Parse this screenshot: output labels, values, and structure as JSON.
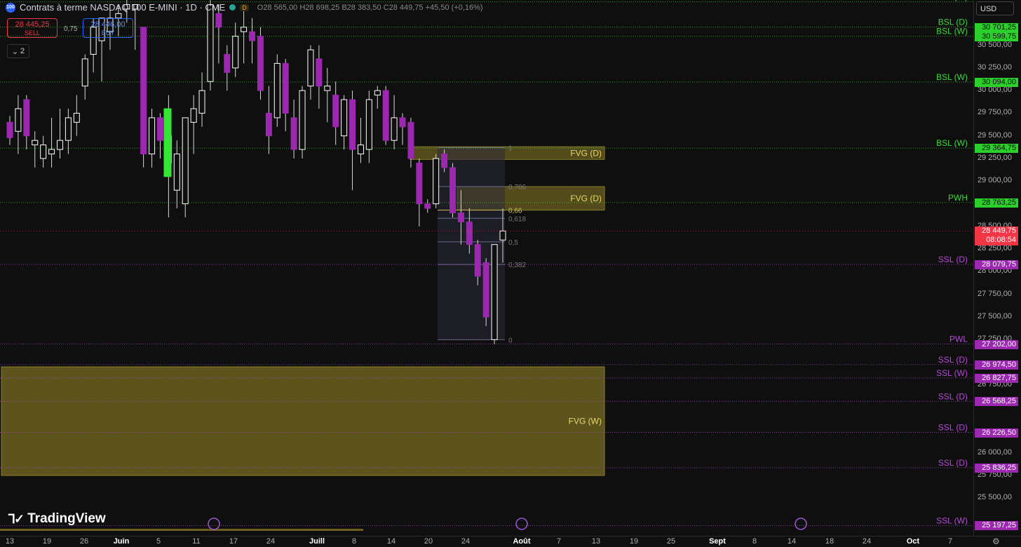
{
  "header": {
    "badge": "100",
    "title": "Contrats à terme NASDAQ 100 E-MINI · 1D · CME",
    "market_flag": "D",
    "ohlc": [
      {
        "k": "O",
        "v": "28 565,00"
      },
      {
        "k": "H",
        "v": "28 698,25"
      },
      {
        "k": "B",
        "v": "28 383,50"
      },
      {
        "k": "C",
        "v": "28 449,75"
      }
    ],
    "change": "+45,50 (+0,16%)"
  },
  "trade": {
    "sell_price": "28 445,25",
    "sell_label": "SELL",
    "buy_price": "28 446,00",
    "buy_label": "BUY",
    "spread": "0,75"
  },
  "indicators_count": "2",
  "currency": "USD",
  "logo_text": "TradingView",
  "colors": {
    "bull": "#ffffff",
    "bear": "#9c27b0",
    "green_level": "#3cd83c",
    "purple_level": "#b44bd6",
    "fvg": "#6b6020",
    "last_price": "#f23645"
  },
  "chart_data": {
    "type": "candlestick",
    "y_range": [
      25100,
      31000
    ],
    "price_ticks": [
      30500,
      30250,
      30000,
      29750,
      29500,
      29250,
      29000,
      28500,
      28250,
      28000,
      27750,
      27500,
      27250,
      26750,
      26000,
      25750,
      25500
    ],
    "price_tick_labels": [
      "30 500,00",
      "30 250,00",
      "30 000,00",
      "29 750,00",
      "29 500,00",
      "29 250,00",
      "29 000,00",
      "28 500,00",
      "28 250,00",
      "28 000,00",
      "27 750,00",
      "27 500,00",
      "27 250,00",
      "26 750,00",
      "26 000,00",
      "25 750,00",
      "25 500,00"
    ],
    "time_labels": [
      {
        "t": "13",
        "day": 0
      },
      {
        "t": "19",
        "day": 6
      },
      {
        "t": "26",
        "day": 13
      },
      {
        "t": "Juin",
        "day": 19,
        "strong": true
      },
      {
        "t": "5",
        "day": 23
      },
      {
        "t": "11",
        "day": 29
      },
      {
        "t": "17",
        "day": 35
      },
      {
        "t": "24",
        "day": 42
      },
      {
        "t": "Juill",
        "day": 49,
        "strong": true
      },
      {
        "t": "8",
        "day": 56
      },
      {
        "t": "14",
        "day": 62
      },
      {
        "t": "20",
        "day": 68
      },
      {
        "t": "24",
        "day": 72
      },
      {
        "t": "Août",
        "day": 80,
        "strong": true
      },
      {
        "t": "7",
        "day": 86
      },
      {
        "t": "13",
        "day": 92
      },
      {
        "t": "19",
        "day": 98
      },
      {
        "t": "25",
        "day": 104
      },
      {
        "t": "Sept",
        "day": 111,
        "strong": true
      },
      {
        "t": "8",
        "day": 118
      },
      {
        "t": "14",
        "day": 124
      },
      {
        "t": "18",
        "day": 128
      },
      {
        "t": "24",
        "day": 134
      },
      {
        "t": "Oct",
        "day": 141,
        "strong": true
      },
      {
        "t": "7",
        "day": 147
      }
    ],
    "candles": [
      {
        "o": 29650,
        "h": 29720,
        "l": 29400,
        "c": 29480
      },
      {
        "o": 29550,
        "h": 29950,
        "l": 29300,
        "c": 29800
      },
      {
        "o": 29900,
        "h": 29950,
        "l": 29350,
        "c": 29500
      },
      {
        "o": 29400,
        "h": 29550,
        "l": 29150,
        "c": 29450
      },
      {
        "o": 29250,
        "h": 29500,
        "l": 29150,
        "c": 29400
      },
      {
        "o": 29300,
        "h": 29700,
        "l": 29150,
        "c": 29350
      },
      {
        "o": 29350,
        "h": 29800,
        "l": 29250,
        "c": 29450
      },
      {
        "o": 29450,
        "h": 29800,
        "l": 29300,
        "c": 29700
      },
      {
        "o": 29650,
        "h": 29950,
        "l": 29500,
        "c": 29750
      },
      {
        "o": 30050,
        "h": 30400,
        "l": 29900,
        "c": 30350
      },
      {
        "o": 30400,
        "h": 30800,
        "l": 30200,
        "c": 30700
      },
      {
        "o": 30550,
        "h": 30800,
        "l": 30100,
        "c": 30800
      },
      {
        "o": 30650,
        "h": 30900,
        "l": 30450,
        "c": 30800
      },
      {
        "o": 30800,
        "h": 30950,
        "l": 30600,
        "c": 30850
      },
      {
        "o": 30900,
        "h": 31000,
        "l": 30750,
        "c": 30950
      },
      {
        "o": 30900,
        "h": 30950,
        "l": 30450,
        "c": 30950
      },
      {
        "o": 30700,
        "h": 30700,
        "l": 29150,
        "c": 29300
      },
      {
        "o": 29300,
        "h": 29800,
        "l": 29150,
        "c": 29700
      },
      {
        "o": 29700,
        "h": 29750,
        "l": 29250,
        "c": 29450
      },
      {
        "o": 29200,
        "h": 29950,
        "l": 28600,
        "c": 29500
      },
      {
        "o": 28900,
        "h": 29450,
        "l": 28700,
        "c": 29300
      },
      {
        "o": 28750,
        "h": 29400,
        "l": 28600,
        "c": 29700
      },
      {
        "o": 29650,
        "h": 29950,
        "l": 29300,
        "c": 29800
      },
      {
        "o": 29750,
        "h": 30200,
        "l": 29600,
        "c": 30000
      },
      {
        "o": 30100,
        "h": 31000,
        "l": 30000,
        "c": 30950
      },
      {
        "o": 30850,
        "h": 30950,
        "l": 30300,
        "c": 30700
      },
      {
        "o": 30400,
        "h": 30500,
        "l": 30000,
        "c": 30200
      },
      {
        "o": 30250,
        "h": 30750,
        "l": 30150,
        "c": 30600
      },
      {
        "o": 30650,
        "h": 30900,
        "l": 30300,
        "c": 30700
      },
      {
        "o": 30650,
        "h": 30800,
        "l": 30300,
        "c": 30550
      },
      {
        "o": 30600,
        "h": 30700,
        "l": 29900,
        "c": 30000
      },
      {
        "o": 29750,
        "h": 30050,
        "l": 29300,
        "c": 29500
      },
      {
        "o": 29700,
        "h": 30400,
        "l": 29600,
        "c": 30300
      },
      {
        "o": 30300,
        "h": 30350,
        "l": 29550,
        "c": 29750
      },
      {
        "o": 29700,
        "h": 29900,
        "l": 29250,
        "c": 29350
      },
      {
        "o": 29350,
        "h": 30050,
        "l": 29250,
        "c": 30000
      },
      {
        "o": 30050,
        "h": 30500,
        "l": 29900,
        "c": 30450
      },
      {
        "o": 30350,
        "h": 30500,
        "l": 29800,
        "c": 30050
      },
      {
        "o": 30000,
        "h": 30250,
        "l": 29650,
        "c": 30050
      },
      {
        "o": 29950,
        "h": 30100,
        "l": 29400,
        "c": 29600
      },
      {
        "o": 29500,
        "h": 29950,
        "l": 29350,
        "c": 29900
      },
      {
        "o": 29900,
        "h": 30000,
        "l": 28900,
        "c": 29350
      },
      {
        "o": 29300,
        "h": 29700,
        "l": 29200,
        "c": 29400
      },
      {
        "o": 29350,
        "h": 30000,
        "l": 29200,
        "c": 29900
      },
      {
        "o": 29950,
        "h": 30050,
        "l": 29800,
        "c": 30000
      },
      {
        "o": 30000,
        "h": 30050,
        "l": 29400,
        "c": 29450
      },
      {
        "o": 29450,
        "h": 29950,
        "l": 29350,
        "c": 29700
      },
      {
        "o": 29700,
        "h": 29750,
        "l": 29400,
        "c": 29600
      },
      {
        "o": 29650,
        "h": 29700,
        "l": 29150,
        "c": 29250
      },
      {
        "o": 29200,
        "h": 29250,
        "l": 28500,
        "c": 28750
      },
      {
        "o": 28750,
        "h": 28800,
        "l": 28650,
        "c": 28700
      },
      {
        "o": 28750,
        "h": 29300,
        "l": 28700,
        "c": 29250
      },
      {
        "o": 29300,
        "h": 29350,
        "l": 29100,
        "c": 29150
      },
      {
        "o": 29150,
        "h": 29200,
        "l": 28600,
        "c": 28650
      },
      {
        "o": 28650,
        "h": 28900,
        "l": 28300,
        "c": 28550
      },
      {
        "o": 28550,
        "h": 28700,
        "l": 28200,
        "c": 28300
      },
      {
        "o": 28300,
        "h": 28350,
        "l": 27850,
        "c": 27950
      },
      {
        "o": 28100,
        "h": 28150,
        "l": 27400,
        "c": 27500
      },
      {
        "o": 27250,
        "h": 28300,
        "l": 27200,
        "c": 28300
      },
      {
        "o": 28350,
        "h": 28698.25,
        "l": 28100,
        "c": 28449.75
      }
    ],
    "series_index_visible_range": [
      0,
      152
    ]
  },
  "levels": [
    {
      "label": "BSL (W)",
      "price_label": "",
      "price": 30980,
      "kind": "green",
      "text_x": 1380,
      "show_tag": false
    },
    {
      "label": "BSL (D)",
      "price_label": "30 701,25",
      "price": 30701.25,
      "kind": "green",
      "text_x": 1380,
      "show_tag": true
    },
    {
      "label": "BSL (W)",
      "price_label": "30 599,75",
      "price": 30599.75,
      "kind": "green",
      "text_x": 1380,
      "show_tag": true
    },
    {
      "label": "BSL (W)",
      "price_label": "30 094,00",
      "price": 30094,
      "kind": "green",
      "text_x": 1380,
      "show_tag": true
    },
    {
      "label": "BSL (W)",
      "price_label": "29 364,75",
      "price": 29364.75,
      "kind": "green",
      "text_x": 1380,
      "show_tag": true
    },
    {
      "label": "PWH",
      "price_label": "28 763,25",
      "price": 28763.25,
      "kind": "green",
      "text_x": 1380,
      "show_tag": true
    },
    {
      "label": "SSL (D)",
      "price_label": "28 079,75",
      "price": 28079.75,
      "kind": "purple",
      "text_x": 1380,
      "show_tag": true
    },
    {
      "label": "PWL",
      "price_label": "27 202,00",
      "price": 27202,
      "kind": "purple",
      "text_x": 1380,
      "show_tag": true
    },
    {
      "label": "SSL (D)",
      "price_label": "26 974,50",
      "price": 26974.5,
      "kind": "purple",
      "text_x": 1380,
      "show_tag": true
    },
    {
      "label": "SSL (W)",
      "price_label": "26 827,75",
      "price": 26827.75,
      "kind": "purple",
      "text_x": 1380,
      "show_tag": true
    },
    {
      "label": "SSL (D)",
      "price_label": "26 568,25",
      "price": 26568.25,
      "kind": "purple",
      "text_x": 1380,
      "show_tag": true
    },
    {
      "label": "SSL (D)",
      "price_label": "26 226,50",
      "price": 26226.5,
      "kind": "purple",
      "text_x": 1380,
      "show_tag": true
    },
    {
      "label": "SSL (D)",
      "price_label": "25 836,25",
      "price": 25836.25,
      "kind": "purple",
      "text_x": 1380,
      "show_tag": true
    },
    {
      "label": "SSL (W)",
      "price_label": "25 197,25",
      "price": 25197.25,
      "kind": "purple",
      "text_x": 1380,
      "show_tag": true
    }
  ],
  "fvgs": [
    {
      "label": "FVG (D)",
      "top": 29380,
      "bottom": 29240,
      "from_day": 95
    },
    {
      "label": "FVG (D)",
      "top": 28940,
      "bottom": 28680,
      "from_day": 106
    },
    {
      "label": "FVG (W)",
      "top": 26950,
      "bottom": 25750,
      "from_day": 0
    }
  ],
  "fib": {
    "levels": [
      {
        "r": "1",
        "price": 29370
      },
      {
        "r": "0,786",
        "price": 28940
      },
      {
        "r": "0,66",
        "price": 28680
      },
      {
        "r": "0,618",
        "price": 28590
      },
      {
        "r": "0,5",
        "price": 28330
      },
      {
        "r": "0,382",
        "price": 28080
      },
      {
        "r": "0",
        "price": 27250
      }
    ]
  },
  "last_price": {
    "price": "28 449,75",
    "countdown": "08:08:54",
    "value": 28449.75
  }
}
